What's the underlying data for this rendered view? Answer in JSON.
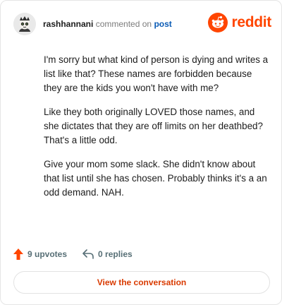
{
  "header": {
    "username": "rashhannani",
    "commented_text": "commented on",
    "post_link": "post",
    "brand": "reddit"
  },
  "comment": {
    "paragraphs": [
      "I'm sorry but what kind of person is dying and writes a list like that? These names are forbidden because they are the kids you won't have with me?",
      "Like they both originally LOVED those names, and she dictates that they are off limits on her deathbed? That's a little odd.",
      "Give your mom some slack. She didn't know about that list until she has chosen. Probably thinks it's a an odd demand. NAH."
    ]
  },
  "actions": {
    "upvotes": "9 upvotes",
    "replies": "0 replies"
  },
  "cta": {
    "label": "View the conversation"
  },
  "colors": {
    "brand": "#ff4500",
    "cta_text": "#d93a00",
    "link": "#0a5bb5"
  }
}
